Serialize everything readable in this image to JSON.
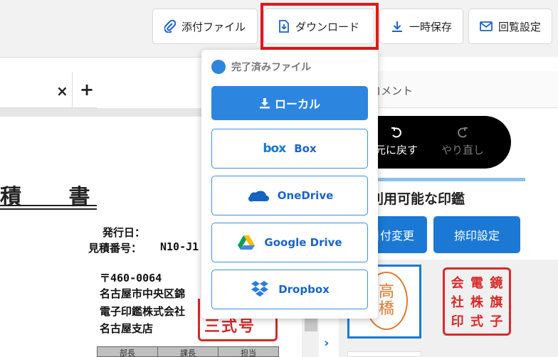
{
  "toolbar": {
    "attach_label": "添付ファイル",
    "download_label": "ダウンロード",
    "save_label": "一時保存",
    "circulation_label": "回覧設定"
  },
  "dropdown": {
    "header": "完了済みファイル",
    "local_label": "ローカル",
    "box_logo": "box",
    "box_label": "Box",
    "onedrive_label": "OneDrive",
    "googledrive_label": "Google Drive",
    "dropbox_label": "Dropbox"
  },
  "document": {
    "tab_close": "×",
    "tab_add": "+",
    "title": "積 書",
    "issue_date_label": "発行日：",
    "quote_no_label": "見積番号：",
    "quote_no_value": "N10-J1",
    "postal": "〒460-0064",
    "address1": "名古屋市中央区錦",
    "company": "電子印鑑株式会社",
    "branch": "名古屋支店",
    "seal_partial_text": "三式号",
    "stamp_headers": [
      "部長",
      "課長",
      "担当"
    ]
  },
  "right_panel": {
    "header_label": "コメント",
    "undo_label": "元に戻す",
    "redo_label": "やり直し",
    "seal_section_title": "利用可能な印鑑",
    "date_change_label": "日付変更",
    "stamp_setting_label": "捺印設定",
    "round_seal_chars": [
      "高",
      "橋"
    ],
    "square_seal_chars": [
      "会",
      "電",
      "鏡",
      "社",
      "株",
      "旗",
      "印",
      "式",
      "子"
    ]
  },
  "colors": {
    "accent": "#2c86e0",
    "highlight": "#e5161b",
    "seal_red": "#d82a2a",
    "seal_orange": "#e07a30"
  }
}
